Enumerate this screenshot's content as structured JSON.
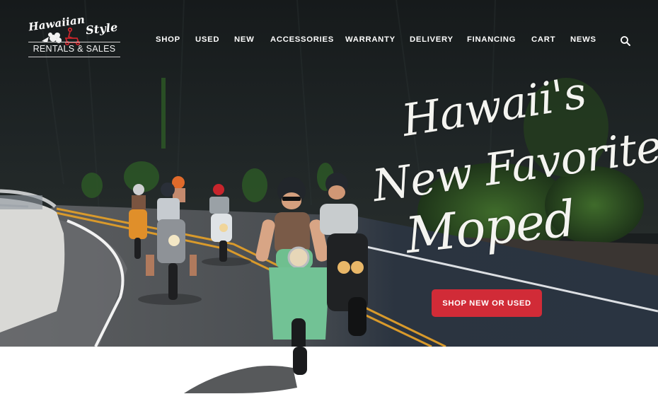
{
  "brand": {
    "script_line_1": "Hawaiian",
    "script_line_2": "Style",
    "subtitle": "RENTALS & SALES"
  },
  "nav": {
    "items": [
      {
        "label": "SHOP"
      },
      {
        "label": "USED"
      },
      {
        "label": "NEW"
      },
      {
        "label": "ACCESSORIES"
      },
      {
        "label": "WARRANTY"
      },
      {
        "label": "DELIVERY"
      },
      {
        "label": "FINANCING"
      },
      {
        "label": "CART"
      },
      {
        "label": "NEWS"
      }
    ],
    "search_icon": "search-icon"
  },
  "hero": {
    "headline_line_1": "Hawaii's",
    "headline_line_2": "New Favorite",
    "headline_line_3": "Moped",
    "cta_label": "SHOP NEW OR USED"
  },
  "colors": {
    "cta": "#d12b37",
    "nav_text": "#ffffff",
    "hero_dark": "#1a1e1f",
    "road_line_yellow": "#d99a2b",
    "logo_moped_red": "#c8252c"
  }
}
